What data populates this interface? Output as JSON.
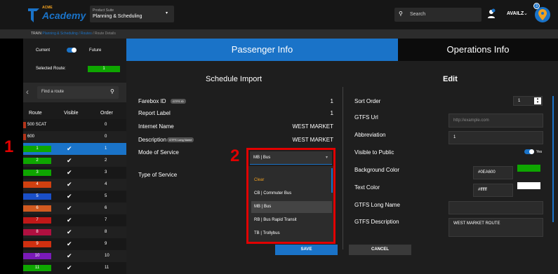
{
  "header": {
    "brand_top": "ACME",
    "brand_main": "Academy",
    "suite_label": "Product Suite",
    "suite_value": "Planning & Scheduling",
    "search_placeholder": "Search",
    "user": "AVAILZ",
    "notif_count": "3"
  },
  "breadcrumb": {
    "root": "TRAIN",
    "path": "Planning & Scheduling / Routes",
    "current": "/ Route Details"
  },
  "sidebar": {
    "current_label": "Current",
    "future_label": "Future",
    "selected_label": "Selected Route:",
    "selected_value": "1",
    "search_placeholder": "Find a route",
    "col_route": "Route",
    "col_visible": "Visible",
    "col_order": "Order",
    "routes": [
      {
        "name": "500 SCAT",
        "visible": "",
        "order": "0",
        "color": "#b2341a"
      },
      {
        "name": "600",
        "visible": "",
        "order": "0",
        "color": "#b2341a"
      },
      {
        "name": "1",
        "visible": "✔",
        "order": "1",
        "color": "#0ea600"
      },
      {
        "name": "2",
        "visible": "✔",
        "order": "2",
        "color": "#0ea600"
      },
      {
        "name": "3",
        "visible": "✔",
        "order": "3",
        "color": "#0ea600"
      },
      {
        "name": "4",
        "visible": "✔",
        "order": "4",
        "color": "#d04010"
      },
      {
        "name": "5",
        "visible": "✔",
        "order": "5",
        "color": "#1a4fc8"
      },
      {
        "name": "6",
        "visible": "✔",
        "order": "6",
        "color": "#d05a20"
      },
      {
        "name": "7",
        "visible": "✔",
        "order": "7",
        "color": "#c01818"
      },
      {
        "name": "8",
        "visible": "✔",
        "order": "8",
        "color": "#b01040"
      },
      {
        "name": "9",
        "visible": "✔",
        "order": "9",
        "color": "#d03010"
      },
      {
        "name": "10",
        "visible": "✔",
        "order": "10",
        "color": "#7a1ab8"
      },
      {
        "name": "11",
        "visible": "✔",
        "order": "11",
        "color": "#0ea600"
      }
    ]
  },
  "annotations": {
    "one": "1",
    "two": "2"
  },
  "tabs": {
    "passenger": "Passenger Info",
    "operations": "Operations Info"
  },
  "schedule": {
    "title": "Schedule Import",
    "farebox_label": "Farebox ID",
    "farebox_badge": "GTFS ID",
    "farebox_value": "1",
    "report_label": "Report Label",
    "report_value": "1",
    "internet_label": "Internet Name",
    "internet_value": "WEST MARKET",
    "desc_label": "Description",
    "desc_badge": "GTFS Long Name",
    "desc_value": "WEST MARKET",
    "mode_label": "Mode of Service",
    "mode_value": "MB | Bus",
    "type_label": "Type of Service",
    "options": [
      "Clear",
      "CB | Commuter Bus",
      "MB | Bus",
      "RB | Bus Rapid Transit",
      "TB | Trollybus"
    ]
  },
  "edit": {
    "title": "Edit",
    "sort_label": "Sort Order",
    "sort_value": "1",
    "gtfs_url_label": "GTFS Url",
    "gtfs_url_placeholder": "http://example.com",
    "abbr_label": "Abbreviation",
    "abbr_value": "1",
    "visible_label": "Visible to Public",
    "visible_value": "Yes",
    "bg_label": "Background Color",
    "bg_value": "#0EA600",
    "text_label": "Text Color",
    "text_value": "#ffffff",
    "long_label": "GTFS Long Name",
    "long_value": "",
    "desc_label": "GTFS Description",
    "desc_value": "WEST MARKET ROUTE"
  },
  "buttons": {
    "save": "SAVE",
    "cancel": "CANCEL"
  },
  "colors": {
    "accent": "#1a73c8",
    "highlight": "#e10000",
    "bg_swatch": "#0ea600",
    "text_swatch": "#ffffff"
  }
}
